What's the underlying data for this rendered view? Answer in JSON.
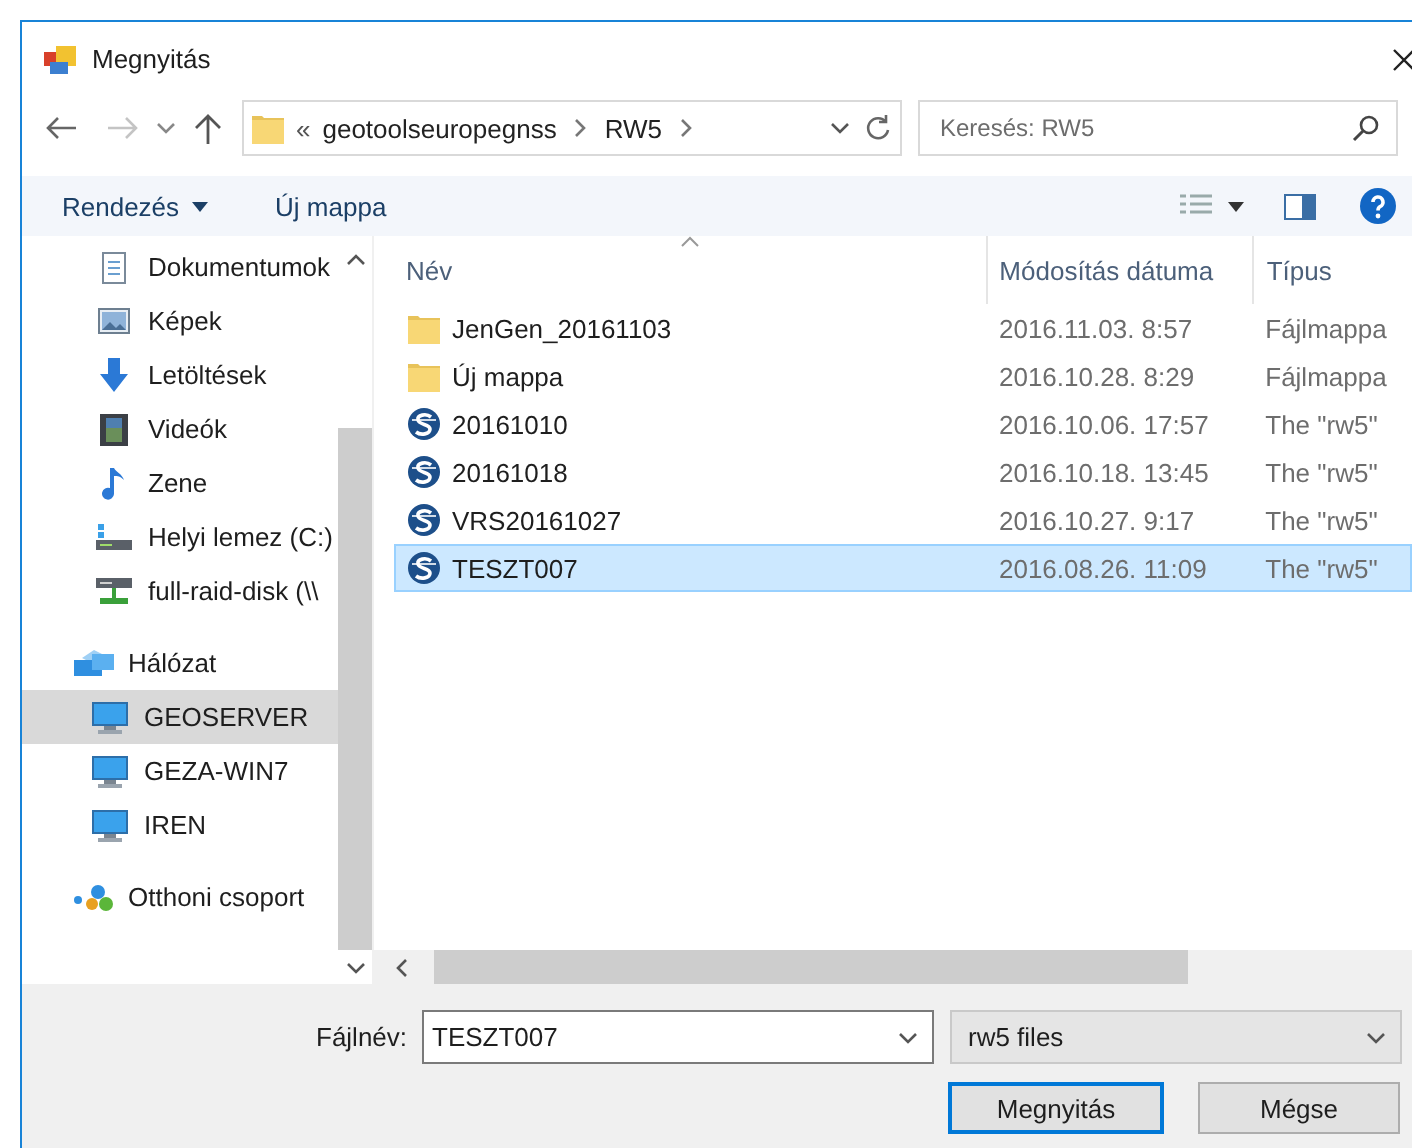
{
  "window": {
    "title": "Megnyitás"
  },
  "navigation": {
    "overflow": "«",
    "path": [
      "geotoolseuropegnss",
      "RW5"
    ]
  },
  "search": {
    "placeholder": "Keresés: RW5"
  },
  "toolbar": {
    "organize": "Rendezés",
    "new_folder": "Új mappa"
  },
  "sidebar": {
    "scrolled_group_items": [
      {
        "kind": "documents",
        "label": "Dokumentumok",
        "selected": false
      },
      {
        "kind": "pictures",
        "label": "Képek",
        "selected": false
      },
      {
        "kind": "downloads",
        "label": "Letöltések",
        "selected": false
      },
      {
        "kind": "videos",
        "label": "Videók",
        "selected": false
      },
      {
        "kind": "music",
        "label": "Zene",
        "selected": false
      },
      {
        "kind": "drive",
        "label": "Helyi lemez (C:)",
        "selected": false
      },
      {
        "kind": "netdrive",
        "label": "full-raid-disk (\\\\",
        "selected": false
      }
    ],
    "items": [
      {
        "kind": "network",
        "label": "Hálózat",
        "selected": false,
        "children": [
          {
            "kind": "computer",
            "label": "GEOSERVER",
            "selected": true
          },
          {
            "kind": "computer",
            "label": "GEZA-WIN7",
            "selected": false
          },
          {
            "kind": "computer",
            "label": "IREN",
            "selected": false
          }
        ]
      },
      {
        "kind": "homegroup",
        "label": "Otthoni csoport",
        "selected": false
      }
    ]
  },
  "file_list": {
    "columns": [
      {
        "label": "Név",
        "sorted": true
      },
      {
        "label": "Módosítás dátuma",
        "sorted": false
      },
      {
        "label": "Típus",
        "sorted": false
      }
    ],
    "rows": [
      {
        "kind": "folder",
        "name": "JenGen_20161103",
        "date": "2016.11.03. 8:57",
        "type": "Fájlmappa",
        "selected": false
      },
      {
        "kind": "folder",
        "name": "Új mappa",
        "date": "2016.10.28. 8:29",
        "type": "Fájlmappa",
        "selected": false
      },
      {
        "kind": "rw5",
        "name": "20161010",
        "date": "2016.10.06. 17:57",
        "type": "The \"rw5\"",
        "selected": false
      },
      {
        "kind": "rw5",
        "name": "20161018",
        "date": "2016.10.18. 13:45",
        "type": "The \"rw5\"",
        "selected": false
      },
      {
        "kind": "rw5",
        "name": "VRS20161027",
        "date": "2016.10.27. 9:17",
        "type": "The \"rw5\"",
        "selected": false
      },
      {
        "kind": "rw5",
        "name": "TESZT007",
        "date": "2016.08.26. 11:09",
        "type": "The \"rw5\"",
        "selected": true
      }
    ]
  },
  "footer": {
    "filename_label": "Fájlnév:",
    "filename": "TESZT007",
    "filter": "rw5 files",
    "buttons": [
      {
        "label": "Megnyitás",
        "default": true
      },
      {
        "label": "Mégse",
        "default": false
      }
    ]
  }
}
